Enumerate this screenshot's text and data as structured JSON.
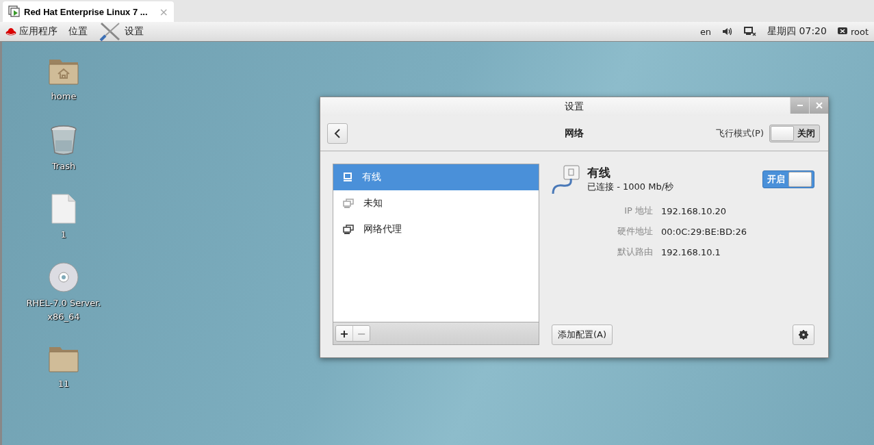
{
  "vm_tab": {
    "title": "Red Hat Enterprise Linux 7 ...",
    "close": "×"
  },
  "top_bar": {
    "menus": [
      {
        "kind": "apps",
        "label": "应用程序"
      },
      {
        "kind": "places",
        "label": "位置"
      },
      {
        "kind": "settings",
        "label": "设置"
      }
    ],
    "language": "en",
    "clock": "星期四 07:20",
    "user": "root"
  },
  "desktop_icons": [
    {
      "kind": "home-folder",
      "label": "home"
    },
    {
      "kind": "trash",
      "label": "Trash"
    },
    {
      "kind": "file",
      "label": "1"
    },
    {
      "kind": "dvd",
      "label": "RHEL-7.0 Server. x86_64"
    },
    {
      "kind": "folder",
      "label": "11"
    }
  ],
  "settings_window": {
    "title": "设置",
    "header": "网络",
    "airplane_mode": {
      "label": "飞行模式(P)",
      "on": false,
      "state_text": "关闭"
    },
    "connections": [
      {
        "kind": "wired",
        "label": "有线",
        "selected": true
      },
      {
        "kind": "unknown",
        "label": "未知",
        "selected": false
      },
      {
        "kind": "proxy",
        "label": "网络代理",
        "selected": false
      }
    ],
    "list_buttons": [
      {
        "label": "+",
        "disabled": false
      },
      {
        "label": "−",
        "disabled": true
      }
    ],
    "detail": {
      "title": "有线",
      "status": "已连接 - 1000 Mb/秒",
      "switch": {
        "on": true,
        "state_text": "开启"
      },
      "properties": [
        {
          "label": "IP 地址",
          "value": "192.168.10.20"
        },
        {
          "label": "硬件地址",
          "value": "00:0C:29:BE:BD:26"
        },
        {
          "label": "默认路由",
          "value": "192.168.10.1"
        }
      ],
      "add_profile_button": "添加配置(A)"
    }
  }
}
